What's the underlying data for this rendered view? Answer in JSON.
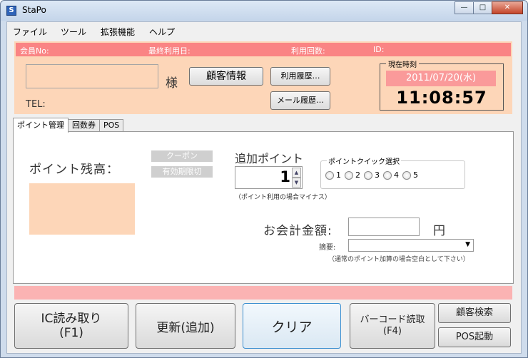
{
  "window": {
    "title": "StaPo",
    "icon": "stapo-app-icon",
    "icon_glyph": "S"
  },
  "menu": [
    "ファイル",
    "ツール",
    "拡張機能",
    "ヘルプ"
  ],
  "info_bar": {
    "member_no": "会員No:",
    "last_used": "最終利用日:",
    "use_count": "利用回数:",
    "id": "ID:"
  },
  "customer": {
    "name_value": "",
    "honorific": "様",
    "tel_label": "TEL:",
    "info_button": "顧客情報",
    "history_button": "利用履歴…",
    "mail_history_button": "メール履歴…"
  },
  "clock": {
    "label": "現在時刻",
    "date": "2011/07/20(水)",
    "time": "11:08:57"
  },
  "tabs": [
    {
      "label": "ポイント管理",
      "active": true
    },
    {
      "label": "回数券",
      "active": false
    },
    {
      "label": "POS",
      "active": false
    }
  ],
  "points": {
    "balance_label": "ポイント残高：",
    "coupon_label": "クーポン",
    "expiry_label": "有効期限切",
    "add_label": "追加ポイント",
    "add_value": "1",
    "add_note": "（ポイント利用の場合マイナス）",
    "quick_label": "ポイントクイック選択",
    "quick_options": [
      "1",
      "2",
      "3",
      "4",
      "5"
    ]
  },
  "payment": {
    "amount_label": "お会計金額:",
    "amount_value": "",
    "currency": "円",
    "memo_label": "摘要:",
    "memo_value": "",
    "memo_note": "（通常のポイント加算の場合空白として下さい）"
  },
  "actions": {
    "ic_read_line1": "IC読み取り",
    "ic_read_line2": "(F1)",
    "update": "更新(追加)",
    "clear": "クリア",
    "barcode_line1": "バーコード読取",
    "barcode_line2": "(F4)",
    "customer_search": "顧客検索",
    "pos_launch": "POS起動"
  },
  "colors": {
    "peach": "#fdd6b8",
    "red_bar": "#fa8484",
    "pink_bar": "#fbb3b3",
    "date_bg": "#fa9a9a"
  }
}
